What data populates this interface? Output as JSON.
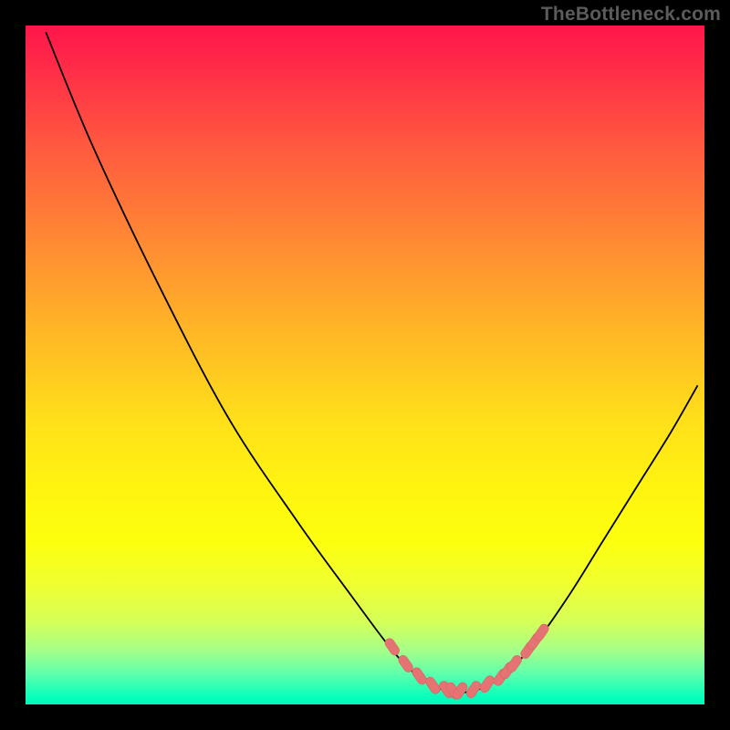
{
  "watermark": "TheBottleneck.com",
  "colors": {
    "background": "#000000",
    "gradient_top": "#ff154a",
    "gradient_mid": "#ffdf1a",
    "gradient_bottom": "#06ffbc",
    "curve": "#000000",
    "markers": "#e57373"
  },
  "chart_data": {
    "type": "line",
    "title": "",
    "xlabel": "",
    "ylabel": "",
    "xlim": [
      0,
      100
    ],
    "ylim": [
      0,
      100
    ],
    "grid": false,
    "series": [
      {
        "name": "bottleneck-curve",
        "x": [
          3,
          10,
          20,
          30,
          40,
          48,
          54,
          58,
          62,
          66,
          70,
          75,
          80,
          85,
          90,
          95,
          99
        ],
        "y": [
          99,
          82,
          61,
          42,
          27,
          16,
          8,
          4,
          2,
          2,
          4,
          9,
          16,
          24,
          32,
          40,
          47
        ]
      }
    ],
    "markers": {
      "name": "highlighted-range",
      "x": [
        54,
        56,
        58,
        60,
        62,
        63,
        64,
        66,
        68,
        70,
        71,
        72,
        74,
        75,
        76
      ],
      "y": [
        8.5,
        6,
        4.2,
        2.8,
        2.2,
        2,
        2,
        2.2,
        3,
        4,
        5,
        6,
        8,
        9.3,
        10.6
      ]
    }
  }
}
